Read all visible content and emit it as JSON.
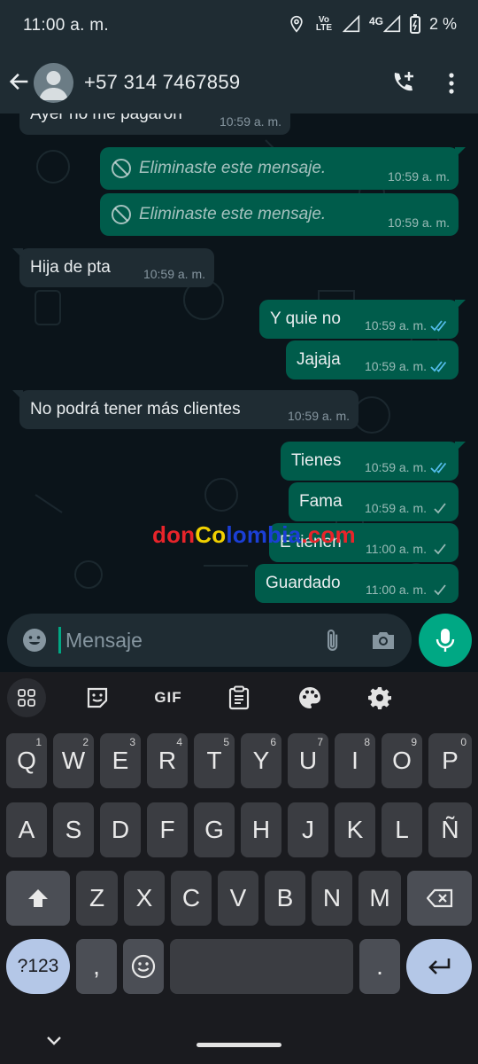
{
  "status_bar": {
    "time": "11:00 a. m.",
    "volte_label": "VoLTE",
    "network": "4G",
    "battery": "2 %"
  },
  "header": {
    "contact": "+57 314 7467859"
  },
  "messages": [
    {
      "dir": "in",
      "text": "Ayer no me pagaron",
      "time": "10:59 a. m.",
      "ticks": ""
    },
    {
      "dir": "out",
      "text": "Eliminaste este mensaje.",
      "time": "10:59 a. m.",
      "ticks": "",
      "deleted": true
    },
    {
      "dir": "out",
      "text": "Eliminaste este mensaje.",
      "time": "10:59 a. m.",
      "ticks": "",
      "deleted": true
    },
    {
      "dir": "in",
      "text": "Hija de pta",
      "time": "10:59 a. m.",
      "ticks": ""
    },
    {
      "dir": "out",
      "text": "Y quie no",
      "time": "10:59 a. m.",
      "ticks": "read"
    },
    {
      "dir": "out",
      "text": "Jajaja",
      "time": "10:59 a. m.",
      "ticks": "read"
    },
    {
      "dir": "in",
      "text": "No podrá tener más clientes",
      "time": "10:59 a. m.",
      "ticks": ""
    },
    {
      "dir": "out",
      "text": "Tienes",
      "time": "10:59 a. m.",
      "ticks": "read"
    },
    {
      "dir": "out",
      "text": "Fama",
      "time": "10:59 a. m.",
      "ticks": "sent"
    },
    {
      "dir": "out",
      "text": "E tienen",
      "time": "11:00 a. m.",
      "ticks": "sent"
    },
    {
      "dir": "out",
      "text": "Guardado",
      "time": "11:00 a. m.",
      "ticks": "sent"
    }
  ],
  "watermark": {
    "p1": "don",
    "p2": "Co",
    "p3": "lombia",
    "p4": ".com"
  },
  "input": {
    "placeholder": "Mensaje"
  },
  "keyboard": {
    "toolbar": [
      "apps-grid-icon",
      "sticker-icon",
      "GIF",
      "clipboard-icon",
      "palette-icon",
      "gear-icon"
    ],
    "gif_label": "GIF",
    "row1": [
      [
        "Q",
        "1"
      ],
      [
        "W",
        "2"
      ],
      [
        "E",
        "3"
      ],
      [
        "R",
        "4"
      ],
      [
        "T",
        "5"
      ],
      [
        "Y",
        "6"
      ],
      [
        "U",
        "7"
      ],
      [
        "I",
        "8"
      ],
      [
        "O",
        "9"
      ],
      [
        "P",
        "0"
      ]
    ],
    "row2": [
      "A",
      "S",
      "D",
      "F",
      "G",
      "H",
      "J",
      "K",
      "L",
      "Ñ"
    ],
    "row3": [
      "Z",
      "X",
      "C",
      "V",
      "B",
      "N",
      "M"
    ],
    "symbols_label": "?123",
    "comma": ",",
    "period": "."
  },
  "colors": {
    "outgoing_bubble": "#005c4b",
    "incoming_bubble": "#1f2c33",
    "accent": "#00a884",
    "read_ticks": "#53bdeb"
  }
}
